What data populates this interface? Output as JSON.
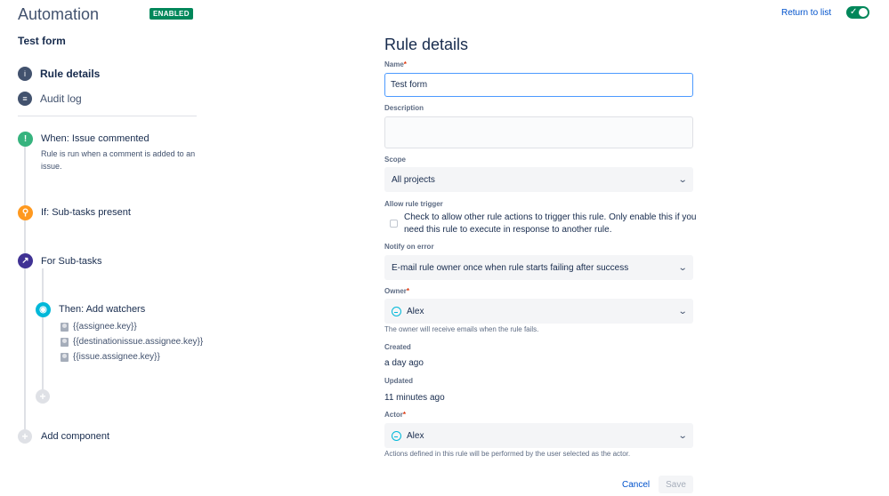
{
  "header": {
    "title": "Automation",
    "badge": "ENABLED",
    "return_link": "Return to list",
    "toggle_check": "✓"
  },
  "sidebar": {
    "rule_name": "Test form",
    "nav": [
      {
        "label": "Rule details",
        "icon": "info-icon",
        "glyph": "i"
      },
      {
        "label": "Audit log",
        "icon": "list-icon",
        "glyph": "≡"
      }
    ],
    "components": {
      "trigger": {
        "label": "When: Issue commented",
        "desc": "Rule is run when a comment is added to an issue.",
        "icon": "comment-icon",
        "glyph": "!",
        "color": "#36b37e"
      },
      "condition": {
        "label": "If: Sub-tasks present",
        "icon": "link-icon",
        "glyph": "⚲",
        "color": "#ff991f"
      },
      "branch": {
        "label": "For Sub-tasks",
        "icon": "branch-icon",
        "glyph": "↗",
        "color": "#403294"
      },
      "action": {
        "label": "Then: Add watchers",
        "icon": "eye-icon",
        "glyph": "◉",
        "color": "#00b8d9",
        "watchers": [
          "{{assignee.key}}",
          "{{destinationissue.assignee.key}}",
          "{{issue.assignee.key}}"
        ]
      },
      "add_component": "Add component",
      "plus": "+"
    }
  },
  "form": {
    "title": "Rule details",
    "name": {
      "label": "Name",
      "required": "*",
      "value": "Test form"
    },
    "description": {
      "label": "Description"
    },
    "scope": {
      "label": "Scope",
      "value": "All projects"
    },
    "allow_trigger": {
      "label": "Allow rule trigger",
      "text": "Check to allow other rule actions to trigger this rule. Only enable this if you need this rule to execute in response to another rule.",
      "checked": false
    },
    "notify": {
      "label": "Notify on error",
      "value": "E-mail rule owner once when rule starts failing after success"
    },
    "owner": {
      "label": "Owner",
      "required": "*",
      "value": "Alex",
      "helper": "The owner will receive emails when the rule fails."
    },
    "created": {
      "label": "Created",
      "value": "a day ago"
    },
    "updated": {
      "label": "Updated",
      "value": "11 minutes ago"
    },
    "actor": {
      "label": "Actor",
      "required": "*",
      "value": "Alex",
      "helper": "Actions defined in this rule will be performed by the user selected as the actor."
    },
    "chevron": "⌄",
    "cancel": "Cancel",
    "save": "Save"
  },
  "colors": {
    "accent": "#0052cc",
    "enabled": "#00875a",
    "focus": "#4c9aff"
  }
}
